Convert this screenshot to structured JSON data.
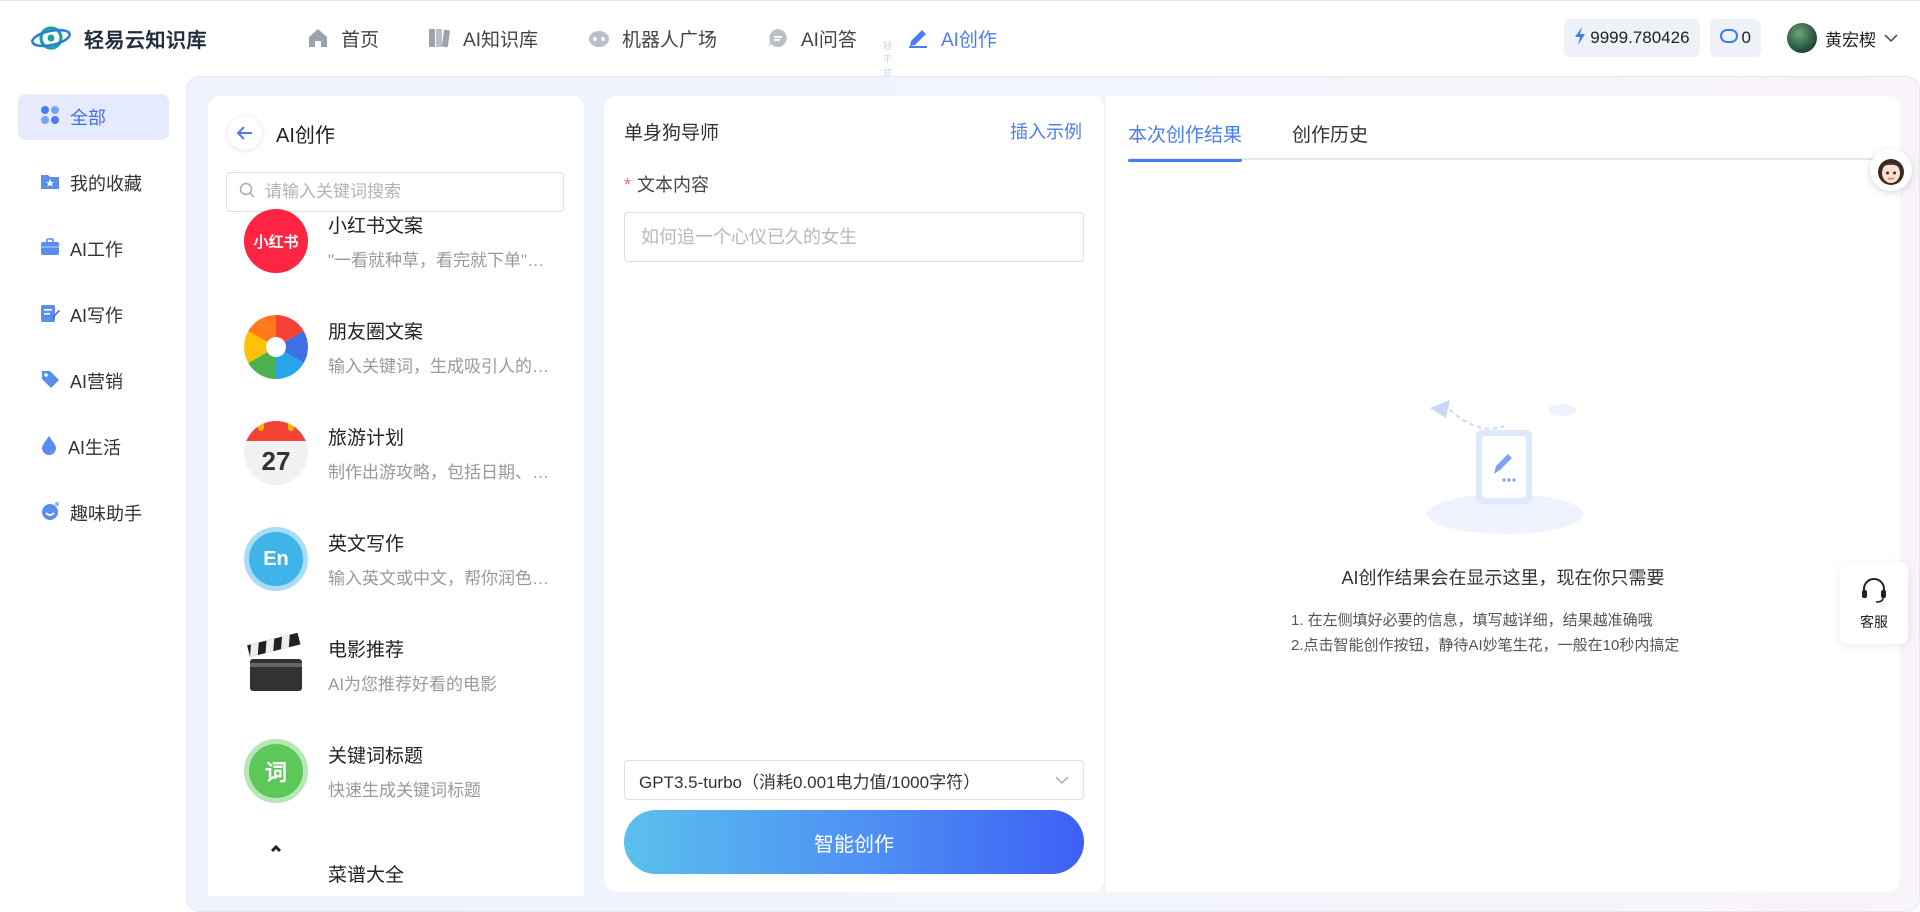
{
  "brand": {
    "name": "轻易云知识库"
  },
  "nav": [
    {
      "label": "首页",
      "icon": "home-icon"
    },
    {
      "label": "AI知识库",
      "icon": "book-icon"
    },
    {
      "label": "机器人广场",
      "icon": "robot-icon"
    },
    {
      "label": "AI问答",
      "icon": "chat-icon",
      "sub": "轻平台"
    },
    {
      "label": "AI创作",
      "icon": "pen-icon",
      "active": true
    }
  ],
  "account": {
    "power": "9999.780426",
    "tokens": "0",
    "username": "黄宏楔"
  },
  "sidebar": [
    {
      "label": "全部",
      "icon": "grid-icon",
      "active": true
    },
    {
      "label": "我的收藏",
      "icon": "star-folder-icon"
    },
    {
      "label": "AI工作",
      "icon": "briefcase-icon"
    },
    {
      "label": "AI写作",
      "icon": "edit-doc-icon"
    },
    {
      "label": "AI营销",
      "icon": "tag-icon"
    },
    {
      "label": "AI生活",
      "icon": "drop-icon"
    },
    {
      "label": "趣味助手",
      "icon": "smile-icon"
    }
  ],
  "list": {
    "title": "AI创作",
    "search_placeholder": "请输入关键词搜索",
    "templates": [
      {
        "title": "小红书文案",
        "desc": "\"一看就种草，看完就下单\"的小红书文案",
        "icon": "xiaohongshu-icon",
        "icon_text": "小红书",
        "color": "#ff2442"
      },
      {
        "title": "朋友圈文案",
        "desc": "输入关键词，生成吸引人的朋友圈文案",
        "icon": "aperture-icon",
        "color": "#4caf50"
      },
      {
        "title": "旅游计划",
        "desc": "制作出游攻略，包括日期、行程安排",
        "icon": "calendar-icon",
        "icon_text": "27",
        "color": "#f44336"
      },
      {
        "title": "英文写作",
        "desc": "输入英文或中文，帮你润色英文文章",
        "icon": "english-icon",
        "icon_text": "En",
        "color": "#3fb4e9"
      },
      {
        "title": "电影推荐",
        "desc": "AI为您推荐好看的电影",
        "icon": "clapperboard-icon",
        "color": "#333333"
      },
      {
        "title": "关键词标题",
        "desc": "快速生成关键词标题",
        "icon": "word-icon",
        "icon_text": "词",
        "color": "#5cc85a"
      },
      {
        "title": "菜谱大全",
        "desc": "",
        "icon": "recipe-icon",
        "color": "#333333"
      }
    ]
  },
  "form": {
    "title": "单身狗导师",
    "insert_example": "插入示例",
    "field_label": "文本内容",
    "field_placeholder": "如何追一个心仪已久的女生",
    "model": "GPT3.5-turbo（消耗0.001电力值/1000字符）",
    "submit": "智能创作"
  },
  "result": {
    "tabs": [
      "本次创作结果",
      "创作历史"
    ],
    "empty_title": "AI创作结果会在显示这里，现在你只需要",
    "tips": [
      "1. 在左侧填好必要的信息，填写越详细，结果越准确哦",
      "2.点击智能创作按钮，静待AI妙笔生花，一般在10秒内搞定"
    ]
  },
  "service": {
    "label": "客服"
  },
  "colors": {
    "accent": "#4a7df0",
    "active_bg": "#e5ebfd"
  }
}
